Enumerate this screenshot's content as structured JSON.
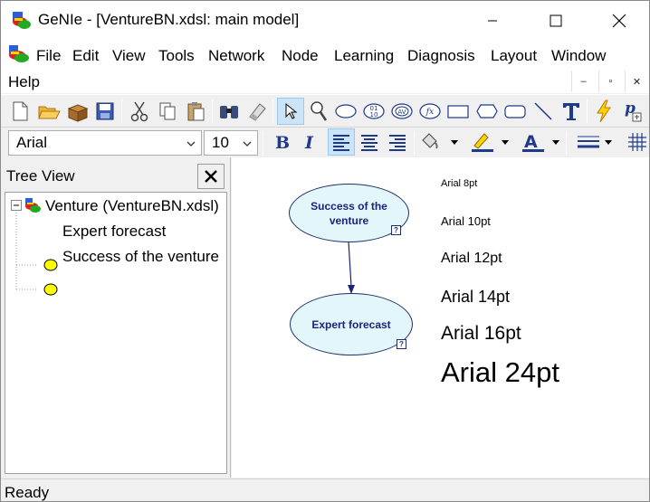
{
  "window": {
    "title": "GeNIe - [VentureBN.xdsl: main model]"
  },
  "menu": {
    "items": [
      "File",
      "Edit",
      "View",
      "Tools",
      "Network",
      "Node",
      "Learning",
      "Diagnosis",
      "Layout",
      "Window",
      "Help"
    ],
    "mdi_min": "–",
    "mdi_restore": "▫",
    "mdi_close": "✕"
  },
  "format_toolbar": {
    "font_family": "Arial",
    "font_size": "10"
  },
  "tree_view": {
    "title": "Tree View",
    "root_label": "Venture (VentureBN.xdsl)",
    "children": [
      "Expert forecast",
      "Success of the venture"
    ]
  },
  "canvas": {
    "nodes": [
      {
        "label": "Success of the venture",
        "badge": "?"
      },
      {
        "label": "Expert forecast",
        "badge": "?"
      }
    ],
    "font_samples": [
      "Arial 8pt",
      "Arial 10pt",
      "Arial 12pt",
      "Arial 14pt",
      "Arial 16pt",
      "Arial 24pt"
    ]
  },
  "status": {
    "text": "Ready"
  },
  "colors": {
    "node_fill": "#e3f6fa",
    "node_text": "#1a237e",
    "tree_node_fill": "#ffff00",
    "selected_tool": "#cce4f7"
  }
}
